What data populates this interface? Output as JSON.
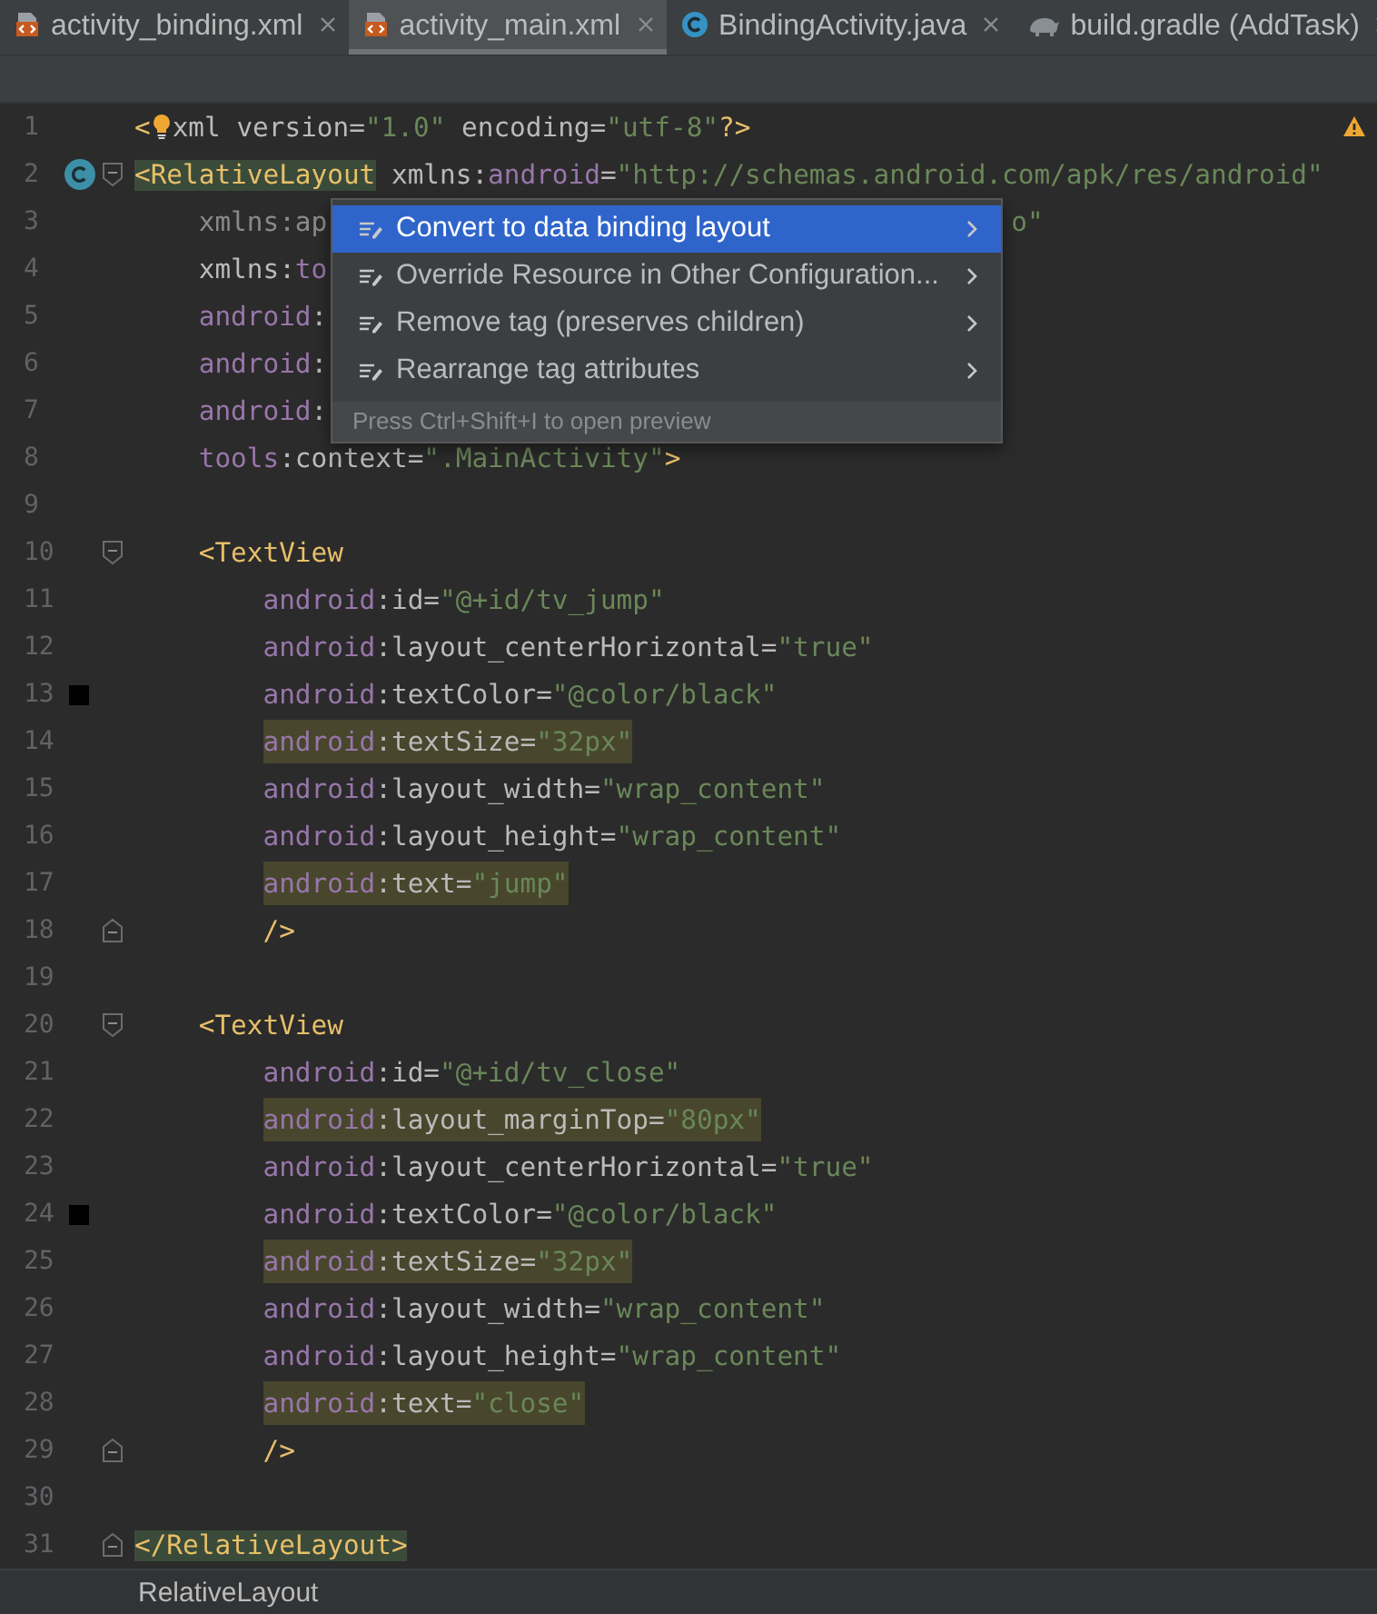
{
  "tabs": [
    {
      "label": "activity_binding.xml",
      "kind": "xml",
      "selected": false
    },
    {
      "label": "activity_main.xml",
      "kind": "xml",
      "selected": true
    },
    {
      "label": "BindingActivity.java",
      "kind": "class",
      "selected": false
    },
    {
      "label": "build.gradle (AddTask)",
      "kind": "gradle",
      "selected": false
    }
  ],
  "editor": {
    "warning": true,
    "lines": [
      {
        "number": "1",
        "tokens": [
          {
            "kind": "tag",
            "text": "<"
          },
          {
            "kind": "bulb"
          },
          {
            "kind": "attr",
            "text": "xml version="
          },
          {
            "kind": "str",
            "text": "\"1.0\""
          },
          {
            "kind": "attr",
            "text": " encoding="
          },
          {
            "kind": "str",
            "text": "\"utf-8\""
          },
          {
            "kind": "tag",
            "text": "?>"
          }
        ]
      },
      {
        "number": "2",
        "class_marker": true,
        "fold_start": true,
        "tag_matched": true,
        "tokens": [
          {
            "kind": "tag",
            "text": "<RelativeLayout"
          },
          {
            "kind": "attr",
            "text": " xmlns:"
          },
          {
            "kind": "ns",
            "text": "android"
          },
          {
            "kind": "attr",
            "text": "="
          },
          {
            "kind": "str",
            "text": "\"http://schemas.android.com/apk/res/android\""
          }
        ],
        "children": [
          {
            "number": "3",
            "tokens": [
              {
                "kind": "dim",
                "text": "xmlns:ap"
              },
              {
                "kind": "tail",
                "text": "o\""
              }
            ]
          },
          {
            "number": "4",
            "tokens": [
              {
                "kind": "attr",
                "text": "xmlns:"
              },
              {
                "kind": "ns",
                "text": "to"
              }
            ]
          },
          {
            "number": "5",
            "tokens": [
              {
                "kind": "ns",
                "text": "android"
              },
              {
                "kind": "attr",
                "text": ":"
              }
            ]
          },
          {
            "number": "6",
            "tokens": [
              {
                "kind": "ns",
                "text": "android"
              },
              {
                "kind": "attr",
                "text": ":"
              }
            ]
          },
          {
            "number": "7",
            "tokens": [
              {
                "kind": "ns",
                "text": "android"
              },
              {
                "kind": "attr",
                "text": ":"
              }
            ]
          },
          {
            "number": "8",
            "tokens": [
              {
                "kind": "ns",
                "text": "tools"
              },
              {
                "kind": "attr",
                "text": ":context="
              },
              {
                "kind": "str",
                "text": "\".MainActivity\""
              },
              {
                "kind": "tag",
                "text": ">"
              }
            ]
          },
          {
            "number": "9"
          },
          {
            "number": "10",
            "fold_start": true,
            "tokens": [
              {
                "kind": "tag",
                "text": "<TextView"
              }
            ],
            "children": [
              {
                "number": "11",
                "tokens": [
                  {
                    "kind": "ns",
                    "text": "android"
                  },
                  {
                    "kind": "attr",
                    "text": ":id="
                  },
                  {
                    "kind": "str",
                    "text": "\"@+id/tv_jump\""
                  }
                ]
              },
              {
                "number": "12",
                "tokens": [
                  {
                    "kind": "ns",
                    "text": "android"
                  },
                  {
                    "kind": "attr",
                    "text": ":layout_centerHorizontal="
                  },
                  {
                    "kind": "str",
                    "text": "\"true\""
                  }
                ]
              },
              {
                "number": "13",
                "color": "#000000",
                "tokens": [
                  {
                    "kind": "ns",
                    "text": "android"
                  },
                  {
                    "kind": "attr",
                    "text": ":textColor="
                  },
                  {
                    "kind": "str",
                    "text": "\"@color/black\""
                  }
                ]
              },
              {
                "number": "14",
                "highlighted": true,
                "tokens": [
                  {
                    "kind": "ns",
                    "text": "android"
                  },
                  {
                    "kind": "attr",
                    "text": ":textSize="
                  },
                  {
                    "kind": "str",
                    "text": "\"32px\""
                  }
                ]
              },
              {
                "number": "15",
                "tokens": [
                  {
                    "kind": "ns",
                    "text": "android"
                  },
                  {
                    "kind": "attr",
                    "text": ":layout_width="
                  },
                  {
                    "kind": "str",
                    "text": "\"wrap_content\""
                  }
                ]
              },
              {
                "number": "16",
                "tokens": [
                  {
                    "kind": "ns",
                    "text": "android"
                  },
                  {
                    "kind": "attr",
                    "text": ":layout_height="
                  },
                  {
                    "kind": "str",
                    "text": "\"wrap_content\""
                  }
                ]
              },
              {
                "number": "17",
                "highlighted": true,
                "tokens": [
                  {
                    "kind": "ns",
                    "text": "android"
                  },
                  {
                    "kind": "attr",
                    "text": ":text="
                  },
                  {
                    "kind": "str",
                    "text": "\"jump\""
                  }
                ]
              },
              {
                "number": "18",
                "fold_end": true,
                "tokens": [
                  {
                    "kind": "tag",
                    "text": "/>"
                  }
                ]
              }
            ]
          },
          {
            "number": "19"
          },
          {
            "number": "20",
            "fold_start": true,
            "tokens": [
              {
                "kind": "tag",
                "text": "<TextView"
              }
            ],
            "children": [
              {
                "number": "21",
                "tokens": [
                  {
                    "kind": "ns",
                    "text": "android"
                  },
                  {
                    "kind": "attr",
                    "text": ":id="
                  },
                  {
                    "kind": "str",
                    "text": "\"@+id/tv_close\""
                  }
                ]
              },
              {
                "number": "22",
                "highlighted": true,
                "tokens": [
                  {
                    "kind": "ns",
                    "text": "android"
                  },
                  {
                    "kind": "attr",
                    "text": ":layout_marginTop="
                  },
                  {
                    "kind": "str",
                    "text": "\"80px\""
                  }
                ]
              },
              {
                "number": "23",
                "tokens": [
                  {
                    "kind": "ns",
                    "text": "android"
                  },
                  {
                    "kind": "attr",
                    "text": ":layout_centerHorizontal="
                  },
                  {
                    "kind": "str",
                    "text": "\"true\""
                  }
                ]
              },
              {
                "number": "24",
                "color": "#000000",
                "tokens": [
                  {
                    "kind": "ns",
                    "text": "android"
                  },
                  {
                    "kind": "attr",
                    "text": ":textColor="
                  },
                  {
                    "kind": "str",
                    "text": "\"@color/black\""
                  }
                ]
              },
              {
                "number": "25",
                "highlighted": true,
                "tokens": [
                  {
                    "kind": "ns",
                    "text": "android"
                  },
                  {
                    "kind": "attr",
                    "text": ":textSize="
                  },
                  {
                    "kind": "str",
                    "text": "\"32px\""
                  }
                ]
              },
              {
                "number": "26",
                "tokens": [
                  {
                    "kind": "ns",
                    "text": "android"
                  },
                  {
                    "kind": "attr",
                    "text": ":layout_width="
                  },
                  {
                    "kind": "str",
                    "text": "\"wrap_content\""
                  }
                ]
              },
              {
                "number": "27",
                "tokens": [
                  {
                    "kind": "ns",
                    "text": "android"
                  },
                  {
                    "kind": "attr",
                    "text": ":layout_height="
                  },
                  {
                    "kind": "str",
                    "text": "\"wrap_content\""
                  }
                ]
              },
              {
                "number": "28",
                "highlighted": true,
                "tokens": [
                  {
                    "kind": "ns",
                    "text": "android"
                  },
                  {
                    "kind": "attr",
                    "text": ":text="
                  },
                  {
                    "kind": "str",
                    "text": "\"close\""
                  }
                ]
              },
              {
                "number": "29",
                "fold_end": true,
                "tokens": [
                  {
                    "kind": "tag",
                    "text": "/>"
                  }
                ]
              }
            ]
          },
          {
            "number": "30"
          }
        ]
      },
      {
        "number": "31",
        "fold_end": true,
        "tag_matched": true,
        "tokens": [
          {
            "kind": "tag",
            "text": "</RelativeLayout>"
          }
        ]
      }
    ]
  },
  "popup": {
    "items": [
      {
        "label": "Convert to data binding layout",
        "selected": true
      },
      {
        "label": "Override Resource in Other Configuration...",
        "selected": false
      },
      {
        "label": "Remove tag (preserves children)",
        "selected": false
      },
      {
        "label": "Rearrange tag attributes",
        "selected": false
      }
    ],
    "hint": "Press Ctrl+Shift+I to open preview"
  },
  "breadcrumb": "RelativeLayout"
}
